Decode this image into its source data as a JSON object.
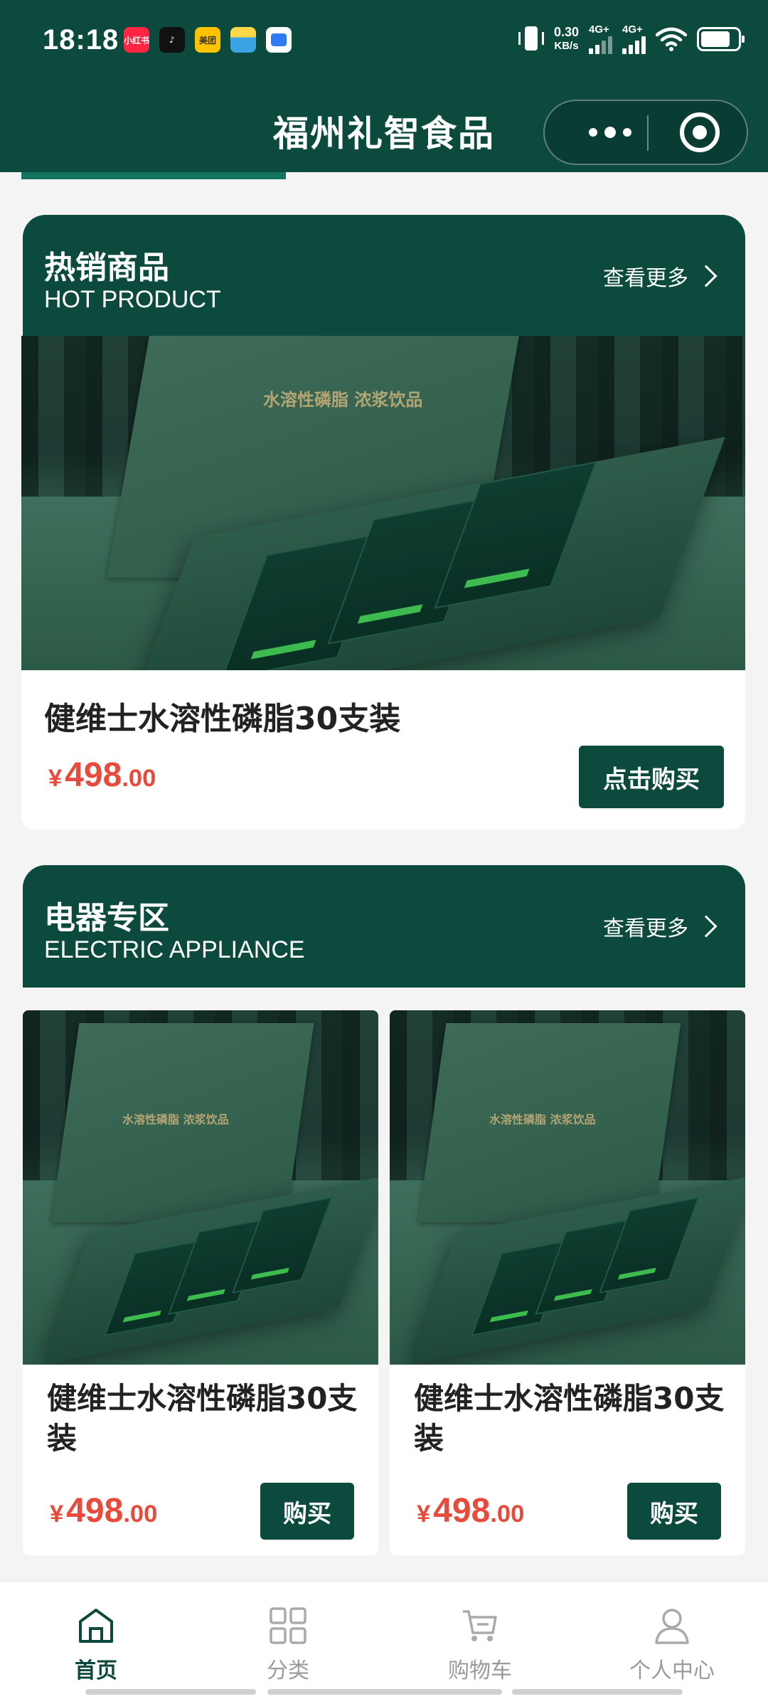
{
  "status_bar": {
    "time": "18:18",
    "app_icons": [
      {
        "name": "xiaohongshu-icon",
        "text": "小红书",
        "color": "#ff2442"
      },
      {
        "name": "douyin-icon",
        "text": "♪",
        "color": "#111111"
      },
      {
        "name": "meituan-icon",
        "text": "美团",
        "color": "#ffc300"
      },
      {
        "name": "notes-app-icon",
        "text": "",
        "color": "#3aa3e3"
      },
      {
        "name": "cloud-app-icon",
        "text": "",
        "color": "#2f7bf5"
      }
    ],
    "net_speed_value": "0.30",
    "net_speed_unit": "KB/s",
    "network_1": "4G+",
    "network_2": "4G+"
  },
  "header": {
    "title": "福州礼智食品"
  },
  "hot_section": {
    "title_cn": "热销商品",
    "title_en": "HOT PRODUCT",
    "more_label": "查看更多",
    "product": {
      "name": "健维士水溶性磷脂30支装",
      "price_symbol": "¥",
      "price_int": "498",
      "price_dec": ".00",
      "buy_label": "点击购买",
      "image_logo": "水溶性磷脂 浓浆饮品"
    }
  },
  "appliance_section": {
    "title_cn": "电器专区",
    "title_en": "ELECTRIC APPLIANCE",
    "more_label": "查看更多",
    "products": [
      {
        "name": "健维士水溶性磷脂30支装",
        "price_symbol": "¥",
        "price_int": "498",
        "price_dec": ".00",
        "buy_label": "购买",
        "image_logo": "水溶性磷脂 浓浆饮品"
      },
      {
        "name": "健维士水溶性磷脂30支装",
        "price_symbol": "¥",
        "price_int": "498",
        "price_dec": ".00",
        "buy_label": "购买",
        "image_logo": "水溶性磷脂 浓浆饮品"
      }
    ]
  },
  "tabbar": {
    "tabs": [
      {
        "label": "首页",
        "icon": "home-icon",
        "active": true
      },
      {
        "label": "分类",
        "icon": "category-grid-icon",
        "active": false
      },
      {
        "label": "购物车",
        "icon": "shopping-cart-icon",
        "active": false
      },
      {
        "label": "个人中心",
        "icon": "user-profile-icon",
        "active": false
      }
    ]
  },
  "colors": {
    "brand_green": "#0c4a3e",
    "price_red": "#e84b3c",
    "tab_inactive": "#9a9a9a"
  }
}
